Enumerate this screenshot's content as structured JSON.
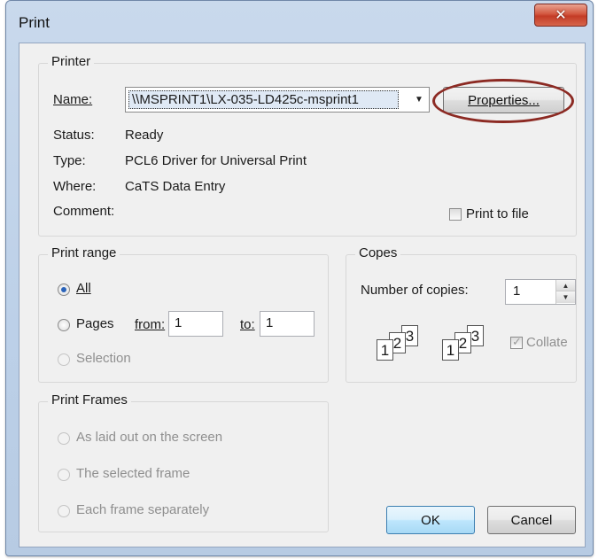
{
  "window": {
    "title": "Print",
    "close_glyph": "✕"
  },
  "printer": {
    "legend": "Printer",
    "name_label": "Name:",
    "name_value": "\\\\MSPRINT1\\LX-035-LD425c-msprint1",
    "properties_label": "Properties...",
    "status_label": "Status:",
    "status_value": "Ready",
    "type_label": "Type:",
    "type_value": "PCL6 Driver for Universal Print",
    "where_label": "Where:",
    "where_value": "CaTS Data Entry",
    "comment_label": "Comment:",
    "print_to_file_label": "Print to file",
    "print_to_file_checked": false
  },
  "print_range": {
    "legend": "Print range",
    "all_label": "All",
    "pages_label": "Pages",
    "from_label": "from:",
    "from_value": "1",
    "to_label": "to:",
    "to_value": "1",
    "selection_label": "Selection",
    "selected": "All"
  },
  "copies": {
    "legend": "Copes",
    "number_label": "Number of copies:",
    "number_value": "1",
    "collate_label": "Collate",
    "collate_checked": true,
    "page_digits": [
      "1",
      "2",
      "3"
    ]
  },
  "print_frames": {
    "legend": "Print Frames",
    "options": [
      "As laid out on the screen",
      "The selected frame",
      "Each frame separately"
    ]
  },
  "buttons": {
    "ok": "OK",
    "cancel": "Cancel"
  },
  "colors": {
    "highlight_ring": "#8c2a23",
    "close_button": "#c33b26",
    "default_button_border": "#3c7fb1"
  }
}
